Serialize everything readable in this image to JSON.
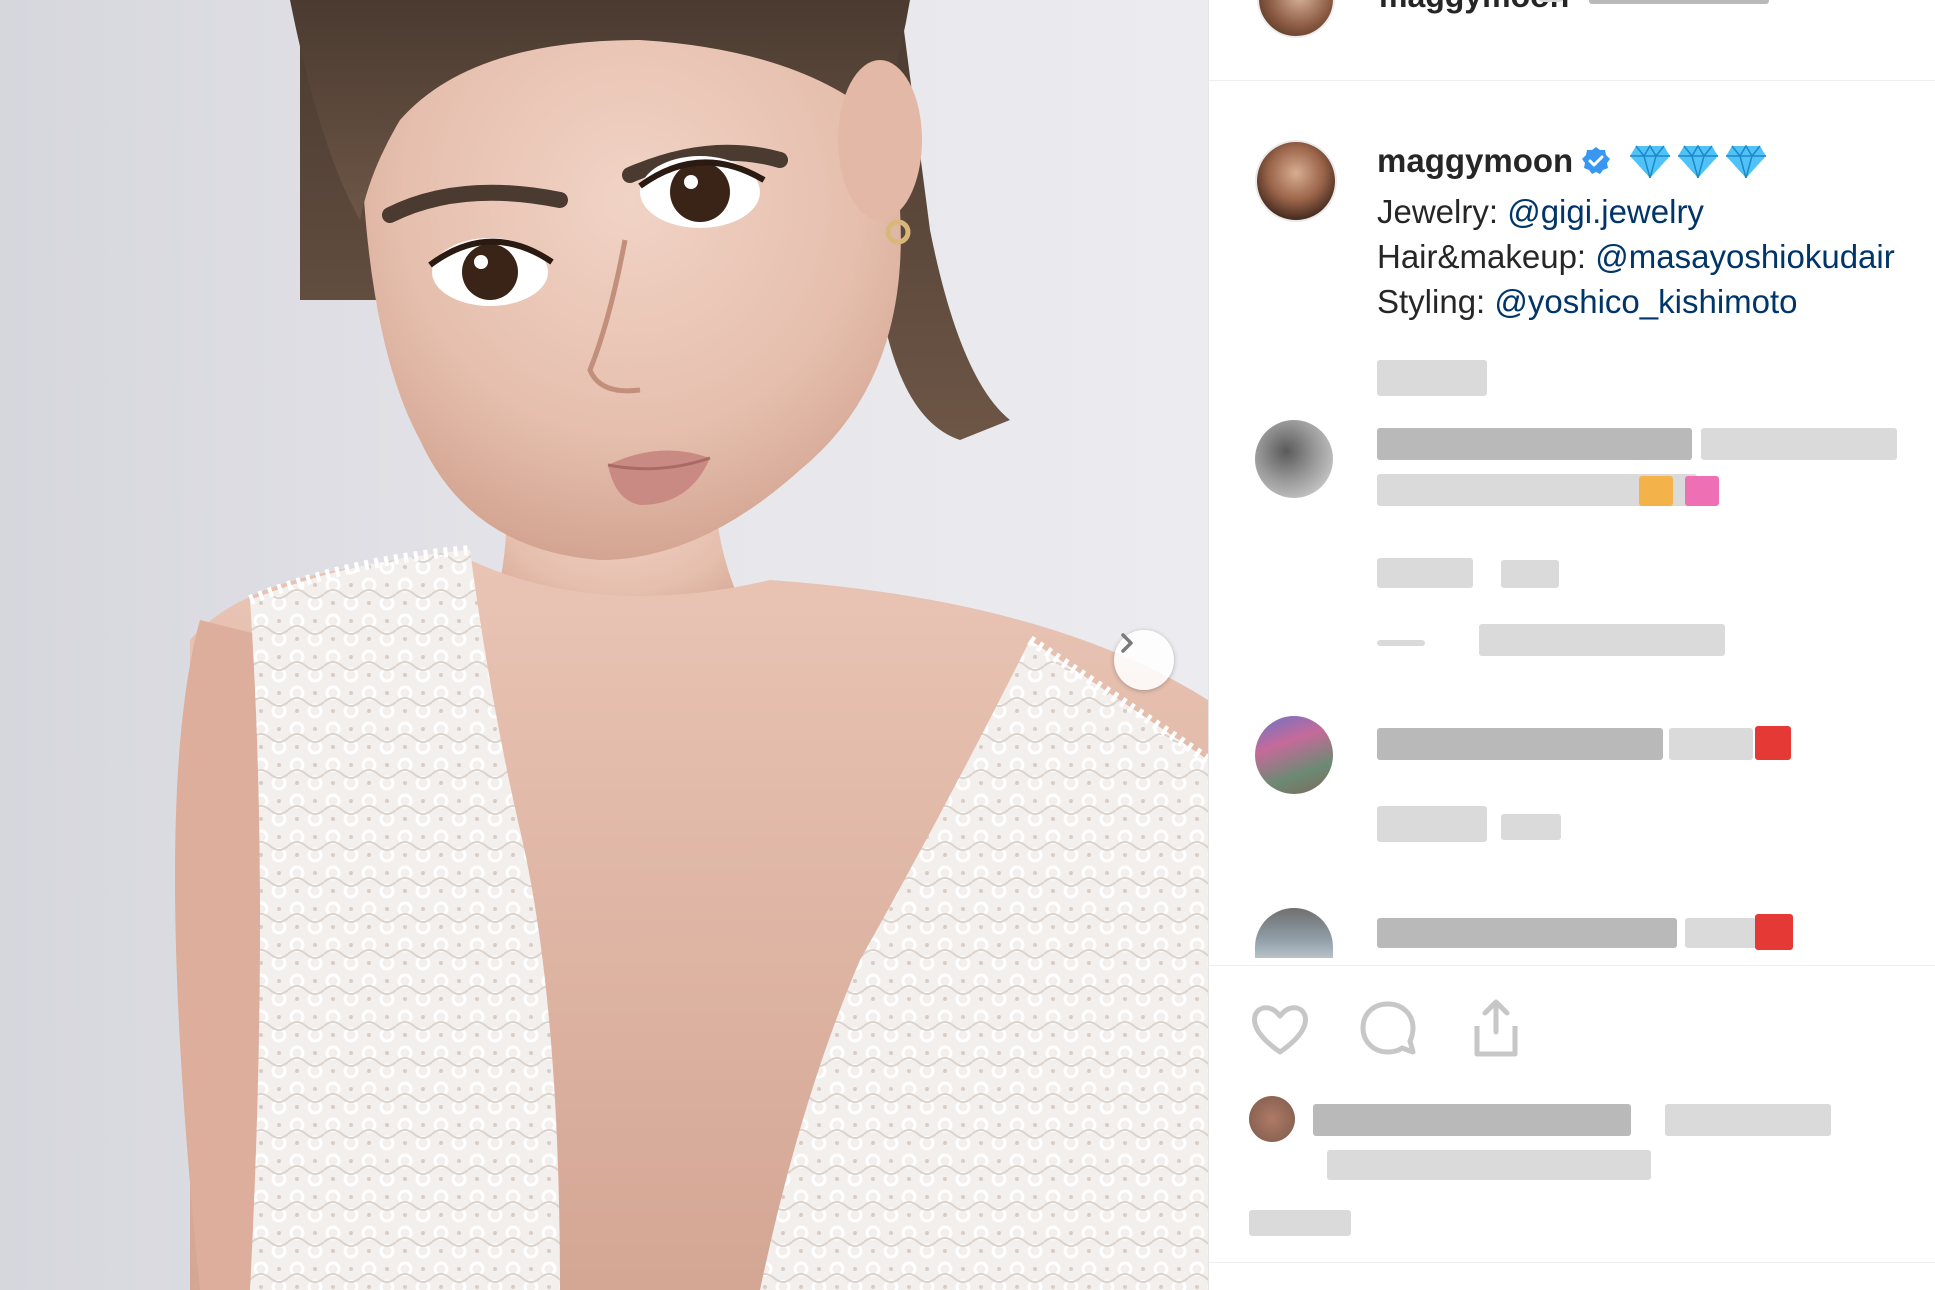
{
  "post": {
    "photo_alt_icon": "photo",
    "next_icon": "chevron-right-icon"
  },
  "header": {
    "username": "maggymoon"
  },
  "caption": {
    "username": "maggymoon",
    "verified_icon": "verified-badge-icon",
    "emoji": "gem-icon",
    "lines": [
      {
        "label": "Jewelry:",
        "mention": "@gigi.jewelry"
      },
      {
        "label": "Hair&makeup:",
        "mention": "@masayoshiokudair"
      },
      {
        "label": "Styling:",
        "mention": "@yoshico_kishimoto"
      }
    ]
  },
  "actions": {
    "like_icon": "heart-icon",
    "comment_icon": "comment-icon",
    "share_icon": "share-icon"
  },
  "colors": {
    "text": "#262626",
    "mention": "#003569",
    "verified": "#3897f0",
    "gem": "#4fc3f7",
    "heart_emoji": "#e53935"
  }
}
